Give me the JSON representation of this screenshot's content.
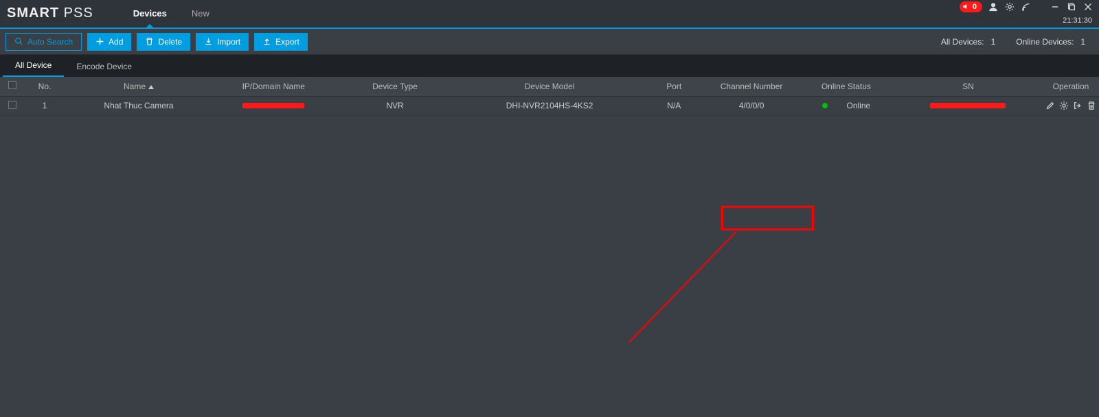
{
  "app": {
    "logo_bold": "SMART",
    "logo_light": " PSS"
  },
  "nav": {
    "devices": "Devices",
    "new": "New"
  },
  "alarm": {
    "count": "0"
  },
  "clock": "21:31:30",
  "toolbar": {
    "auto_search": "Auto Search",
    "add": "Add",
    "delete": "Delete",
    "import": "Import",
    "export": "Export",
    "all_devices_label": "All Devices:",
    "all_devices_value": "1",
    "online_devices_label": "Online Devices:",
    "online_devices_value": "1"
  },
  "subtabs": {
    "all": "All Device",
    "encode": "Encode Device"
  },
  "columns": {
    "no": "No.",
    "name": "Name",
    "ip": "IP/Domain Name",
    "type": "Device Type",
    "model": "Device Model",
    "port": "Port",
    "channel": "Channel Number",
    "status": "Online Status",
    "sn": "SN",
    "op": "Operation"
  },
  "row": {
    "no": "1",
    "name": "Nhat Thuc Camera",
    "ip_redacted": true,
    "type": "NVR",
    "model": "DHI-NVR2104HS-4KS2",
    "port": "N/A",
    "channel": "4/0/0/0",
    "status_text": "Online",
    "sn_redacted": true
  }
}
